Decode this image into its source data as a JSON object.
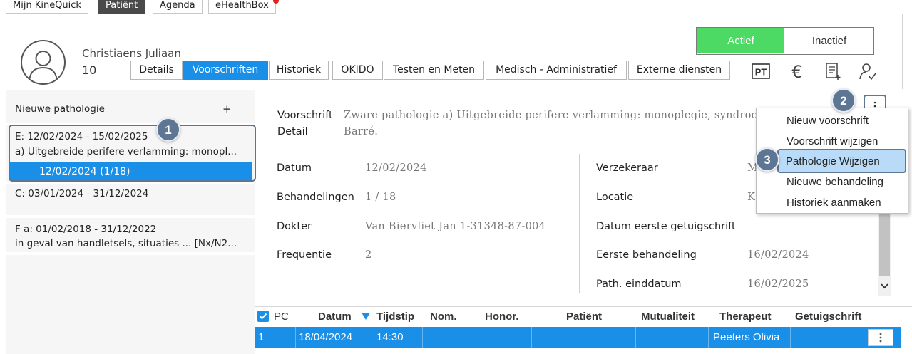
{
  "top_tabs": [
    {
      "label": "Mijn KineQuick",
      "active": false
    },
    {
      "label": "Patiënt",
      "active": true
    },
    {
      "label": "Agenda",
      "active": false
    },
    {
      "label": "eHealthBox",
      "active": false,
      "notification": true
    }
  ],
  "patient": {
    "name": "Christiaens Juliaan",
    "number": "10"
  },
  "subtabs": [
    {
      "label": "Details",
      "active": false
    },
    {
      "label": "Voorschriften",
      "active": true
    },
    {
      "label": "Historiek",
      "active": false
    },
    {
      "label": "OKIDO",
      "active": false
    },
    {
      "label": "Testen en Meten",
      "active": false
    },
    {
      "label": "Medisch - Administratief",
      "active": false
    },
    {
      "label": "Externe diensten",
      "active": false
    }
  ],
  "status": {
    "actief": "Actief",
    "inactief": "Inactief",
    "selected": "Actief",
    "accent_color": "#4cd964"
  },
  "header_icons": [
    "pt-icon",
    "euro-icon",
    "document-add-icon",
    "user-settings-icon"
  ],
  "header_icon_text": {
    "pt": "PT",
    "euro": "€"
  },
  "left": {
    "new_pathology": "Nieuwe pathologie",
    "add_symbol": "+",
    "pathologies": [
      {
        "line1": "E: 12/02/2024 - 15/02/2025",
        "line2": "a) Uitgebreide perifere verlamming: monopl...",
        "sub": "12/02/2024  (1/18)",
        "selected": true
      },
      {
        "line1": "C: 03/01/2024 - 31/12/2024",
        "line2": ""
      },
      {
        "line1": "F a: 01/02/2018 - 31/12/2022",
        "line2": "in geval van handletsels, situaties ... [Nx/N2..."
      }
    ]
  },
  "callouts": [
    "1",
    "2",
    "3"
  ],
  "detail": {
    "voorschrift_label": "Voorschrift",
    "detail_label": "Detail",
    "voorschrift_text_1": "Zware pathologie a) Uitgebreide perifere verlamming: monoplegie, syndroom va",
    "voorschrift_text_2": "Barré.",
    "datum_label": "Datum",
    "datum": "12/02/2024",
    "behandelingen_label": "Behandelingen",
    "behandelingen": "1 / 18",
    "dokter_label": "Dokter",
    "dokter": "Van Biervliet Jan 1-31348-87-004",
    "frequentie_label": "Frequentie",
    "frequentie": "2",
    "verzekeraar_label": "Verzekeraar",
    "verzekeraar": "M",
    "locatie_label": "Locatie",
    "locatie": "K",
    "datum_eerste_label": "Datum eerste getuigschrift",
    "eerste_behandeling_label": "Eerste behandeling",
    "eerste_behandeling": "16/02/2024",
    "path_einddatum_label": "Path. einddatum",
    "path_einddatum": "16/02/2025"
  },
  "menu": {
    "items": [
      "Nieuw voorschrift",
      "Voorschrift wijzigen",
      "Pathologie Wijzigen",
      "Nieuwe behandeling",
      "Historiek aanmaken"
    ],
    "highlighted": "Pathologie Wijzigen"
  },
  "table": {
    "headers": [
      "PC",
      "Datum",
      "Tijdstip",
      "Nom.",
      "Honor.",
      "Patiënt",
      "Mutualiteit",
      "Therapeut",
      "Getuigschrift"
    ],
    "sort_column": "Datum",
    "rows": [
      {
        "pc": "1",
        "datum": "18/04/2024",
        "tijdstip": "14:30",
        "nom": "",
        "honor": "",
        "patient": "",
        "mutualiteit": "",
        "therapeut": "Peeters Olivia",
        "getuigschrift": ""
      }
    ]
  },
  "colors": {
    "selection_blue": "#1a8fe8",
    "callout": "#5c7693",
    "menu_highlight": "#b9dbf7"
  }
}
